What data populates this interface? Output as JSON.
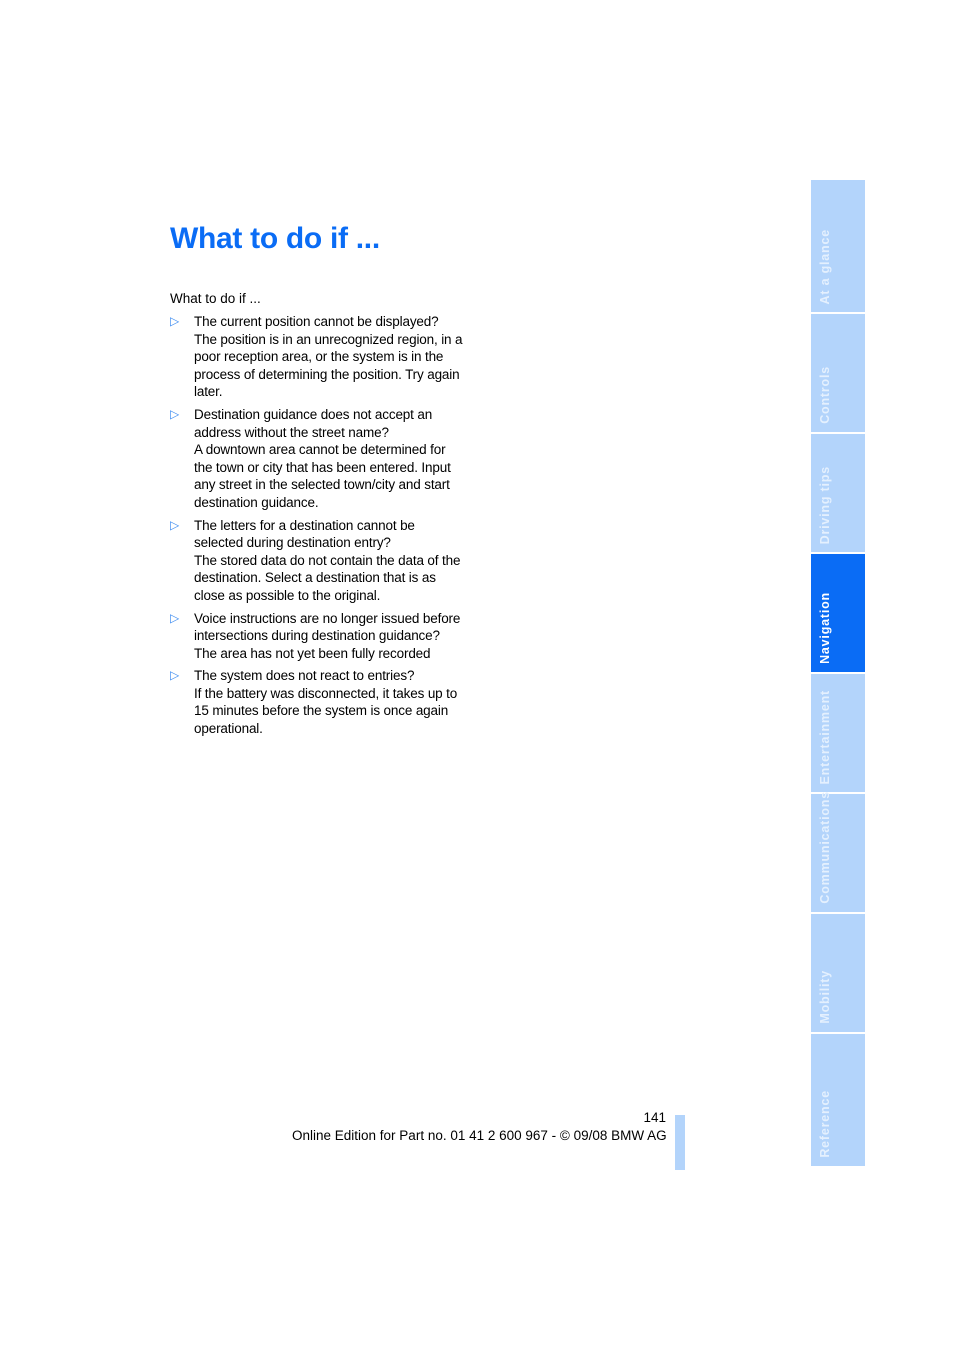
{
  "page": {
    "title": "What to do if ...",
    "intro": "What to do if ...",
    "items": [
      {
        "question": "The current position cannot be displayed?",
        "answer": "The position is in an unrecognized region, in a poor reception area, or the system is in the process of determining the position. Try again later."
      },
      {
        "question": "Destination guidance does not accept an address without the street name?",
        "answer": "A downtown area cannot be determined for the town or city that has been entered. Input any street in the selected town/city and start destination guidance."
      },
      {
        "question": "The letters for a destination cannot be selected during destination entry?",
        "answer": "The stored data do not contain the data of the destination. Select a destination that is as close as possible to the original."
      },
      {
        "question": "Voice instructions are no longer issued before intersections during destination guidance?",
        "answer": "The area has not yet been fully recorded"
      },
      {
        "question": "The system does not react to entries?",
        "answer": "If the battery was disconnected, it takes up to 15 minutes before the system is once again operational."
      }
    ],
    "bullet_icon": "▷"
  },
  "sidebar": {
    "tabs": [
      {
        "label": "At a glance",
        "active": false
      },
      {
        "label": "Controls",
        "active": false
      },
      {
        "label": "Driving tips",
        "active": false
      },
      {
        "label": "Navigation",
        "active": true
      },
      {
        "label": "Entertainment",
        "active": false
      },
      {
        "label": "Communications",
        "active": false
      },
      {
        "label": "Mobility",
        "active": false
      },
      {
        "label": "Reference",
        "active": false
      }
    ]
  },
  "footer": {
    "page_number": "141",
    "edition_text": "Online Edition for Part no. 01 41 2 600 967  - © 09/08 BMW AG"
  },
  "colors": {
    "accent": "#0a6cf5",
    "tab_inactive": "#b3d4fb"
  }
}
